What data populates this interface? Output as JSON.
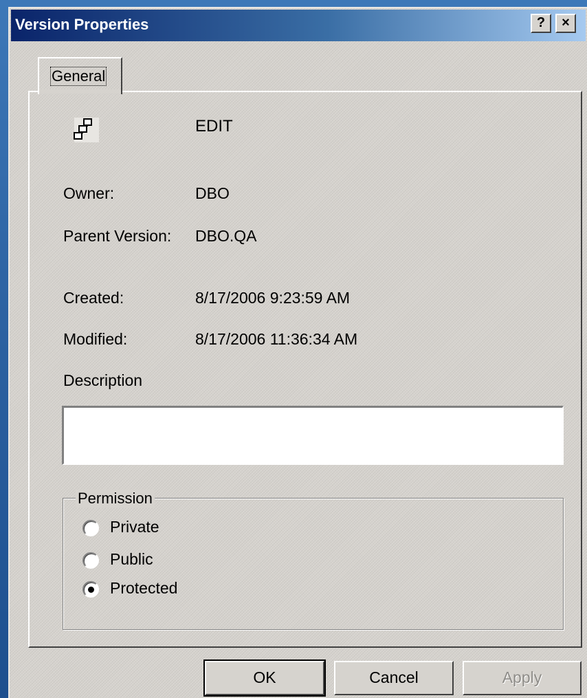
{
  "window": {
    "title": "Version Properties",
    "help_glyph": "?",
    "close_glyph": "×"
  },
  "tabs": [
    {
      "label": "General",
      "selected": true
    }
  ],
  "version": {
    "icon": "version-tree-icon",
    "name": "EDIT"
  },
  "fields": {
    "owner_label": "Owner:",
    "owner_value": "DBO",
    "parent_label": "Parent Version:",
    "parent_value": "DBO.QA",
    "created_label": "Created:",
    "created_value": "8/17/2006 9:23:59 AM",
    "modified_label": "Modified:",
    "modified_value": "8/17/2006 11:36:34 AM",
    "description_label": "Description",
    "description_value": ""
  },
  "permission": {
    "group_label": "Permission",
    "options": [
      {
        "label": "Private",
        "checked": false
      },
      {
        "label": "Public",
        "checked": false
      },
      {
        "label": "Protected",
        "checked": true
      }
    ]
  },
  "buttons": {
    "ok": "OK",
    "cancel": "Cancel",
    "apply": "Apply",
    "apply_enabled": false
  },
  "colors": {
    "titlebar_start": "#0a246a",
    "titlebar_end": "#a6caf0",
    "dialog_face": "#d6d3ce",
    "desktop": "#2e64a4"
  }
}
